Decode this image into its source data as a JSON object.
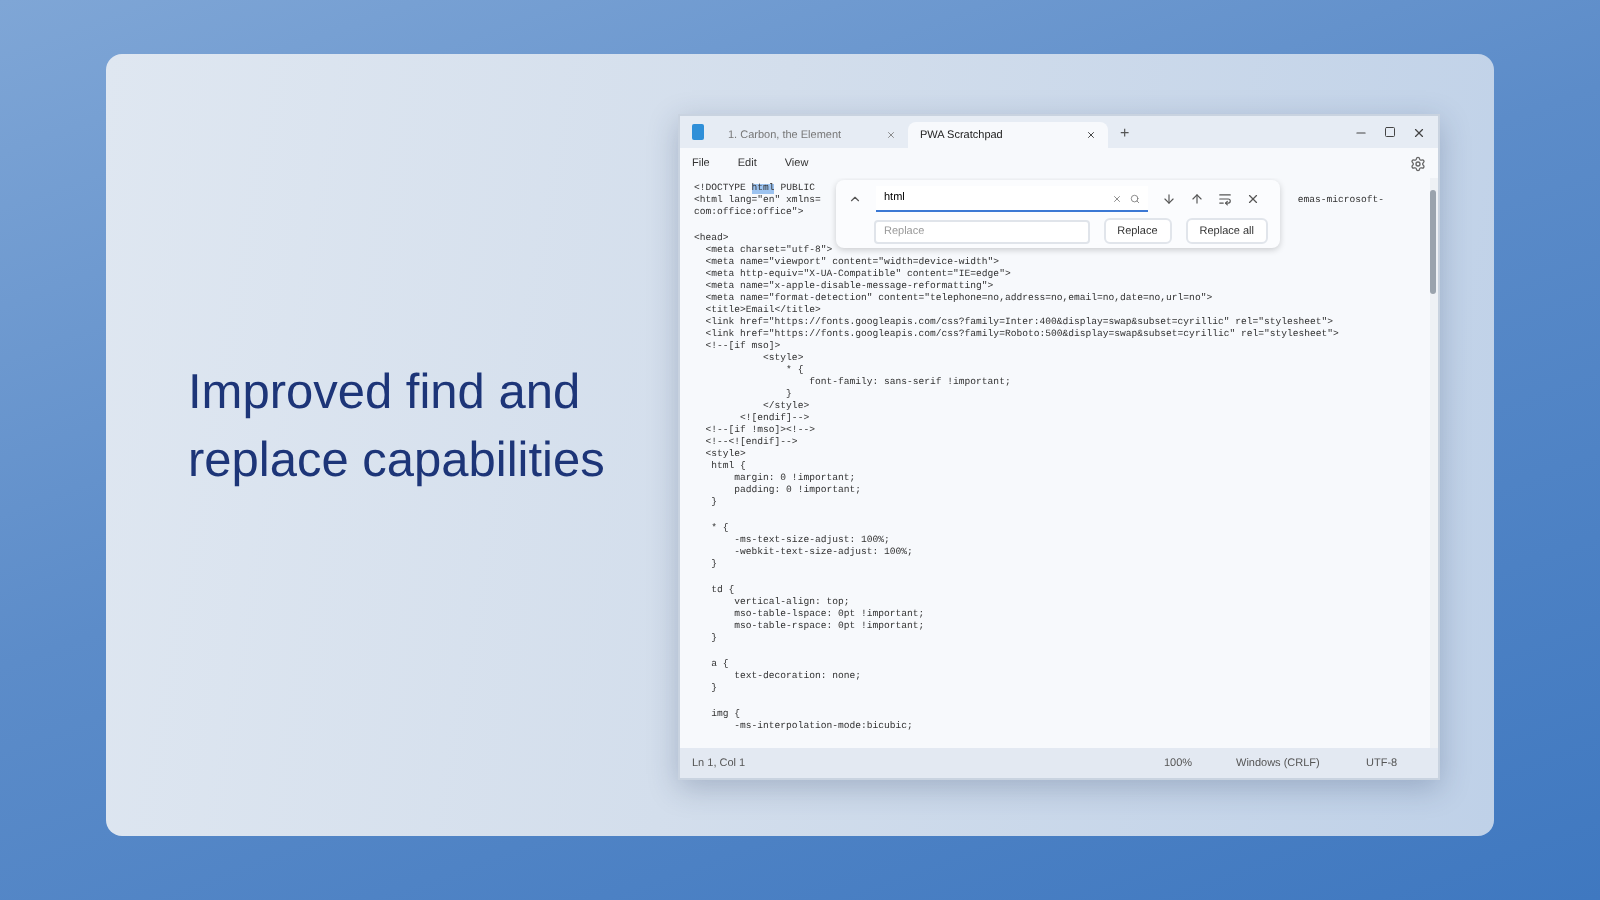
{
  "slide": {
    "heading": "Improved find and replace capabilities"
  },
  "window": {
    "tabs": [
      {
        "label": "1. Carbon, the Element",
        "selected": false
      },
      {
        "label": "PWA Scratchpad",
        "selected": true
      }
    ],
    "new_tab": "+",
    "menu": [
      "File",
      "Edit",
      "View"
    ],
    "find": {
      "query": "html",
      "replace_placeholder": "Replace",
      "buttons": [
        "Replace",
        "Replace all"
      ]
    },
    "editor": {
      "blocks": [
        [
          {
            "before": "<!DOCTYPE ",
            "match": "html",
            "after": " PUBLIC"
          },
          {
            "before": "<html lang=\"en\" xmlns=",
            "tail": "emas-microsoft-"
          },
          {
            "before": "com:office:office\">"
          }
        ],
        [
          {
            "before": "<head>"
          },
          {
            "before": "  <meta charset=\"utf-8\">"
          },
          {
            "before": "  <meta name=\"viewport\" content=\"width=device-width\">"
          },
          {
            "before": "  <meta http-equiv=\"X-UA-Compatible\" content=\"IE=edge\">"
          },
          {
            "before": "  <meta name=\"x-apple-disable-message-reformatting\">"
          },
          {
            "before": "  <meta name=\"format-detection\" content=\"telephone=no,address=no,email=no,date=no,url=no\">"
          },
          {
            "before": "  <title>Email</title>"
          },
          {
            "before": "  <link href=\"https://fonts.googleapis.com/css?family=Inter:400&display=swap&subset=cyrillic\" rel=\"stylesheet\">"
          },
          {
            "before": "  <link href=\"https://fonts.googleapis.com/css?family=Roboto:500&display=swap&subset=cyrillic\" rel=\"stylesheet\">"
          },
          {
            "before": "  <!--[if mso]>"
          },
          {
            "before": "            <style>"
          },
          {
            "before": "                * {"
          },
          {
            "before": "                    font-family: sans-serif !important;"
          },
          {
            "before": "                }"
          },
          {
            "before": "            </style>"
          },
          {
            "before": "        <![endif]-->"
          },
          {
            "before": "  <!--[if !mso]><!-->"
          },
          {
            "before": "  <!--<![endif]-->"
          },
          {
            "before": "  <style>"
          },
          {
            "before": "   html {"
          },
          {
            "before": "       margin: 0 !important;"
          },
          {
            "before": "       padding: 0 !important;"
          },
          {
            "before": "   }"
          }
        ],
        [
          {
            "before": "   * {"
          },
          {
            "before": "       -ms-text-size-adjust: 100%;"
          },
          {
            "before": "       -webkit-text-size-adjust: 100%;"
          },
          {
            "before": "   }"
          }
        ],
        [
          {
            "before": "   td {"
          },
          {
            "before": "       vertical-align: top;"
          },
          {
            "before": "       mso-table-lspace: 0pt !important;"
          },
          {
            "before": "       mso-table-rspace: 0pt !important;"
          },
          {
            "before": "   }"
          }
        ],
        [
          {
            "before": "   a {"
          },
          {
            "before": "       text-decoration: none;"
          },
          {
            "before": "   }"
          }
        ],
        [
          {
            "before": "   img {"
          },
          {
            "before": "       -ms-interpolation-mode:bicubic;"
          }
        ]
      ]
    },
    "status_bar": [
      "Ln 1, Col 1",
      "100%",
      "Windows (CRLF)",
      "UTF-8"
    ]
  }
}
